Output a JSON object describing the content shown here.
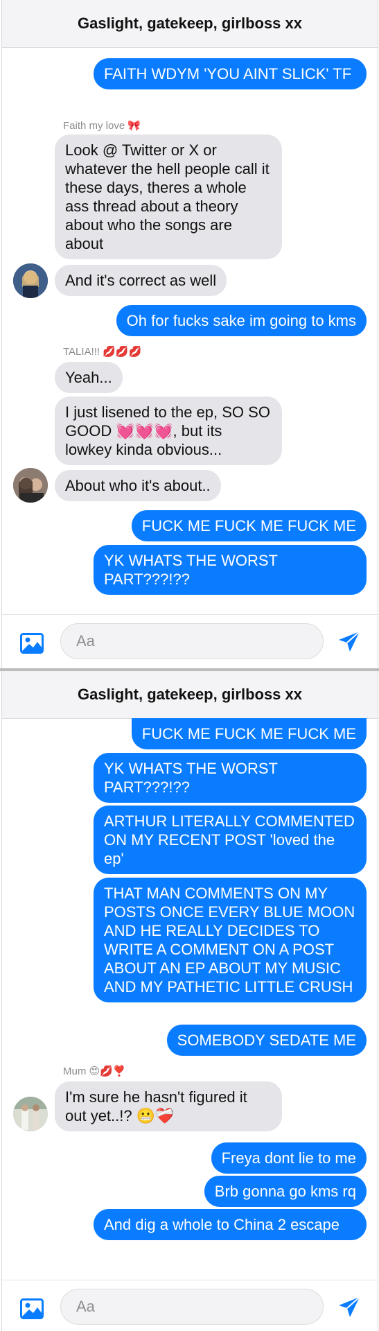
{
  "chat_title": "Gaslight, gatekeep, girlboss xx",
  "input_placeholder": "Aa",
  "senders": {
    "faith": "Faith my love 🎀",
    "talia": "TALIA!!! 💋💋💋",
    "mum": "Mum 😍💋❣️"
  },
  "panel1": {
    "m1": "FAITH WDYM 'YOU AINT SLICK' TF",
    "m2": "Look @ Twitter or X or whatever the hell people call it these days, theres a whole ass thread about a theory about who the songs are about",
    "m3": "And it's correct as well",
    "m4": "Oh for fucks sake im going to kms",
    "m5": "Yeah...",
    "m6": "I just lisened to the ep, SO SO GOOD 💓💓💓, but its lowkey kinda obvious...",
    "m7": "About who it's about..",
    "m8": "FUCK ME FUCK ME FUCK ME",
    "m9": "YK WHATS THE WORST PART???!??"
  },
  "panel2": {
    "m1": "FUCK ME FUCK ME FUCK ME",
    "m2": "YK WHATS THE WORST PART???!??",
    "m3": "ARTHUR LITERALLY COMMENTED ON MY RECENT POST 'loved the ep'",
    "m4": "THAT MAN COMMENTS ON MY POSTS ONCE EVERY BLUE MOON AND HE REALLY DECIDES TO WRITE A COMMENT ON A POST ABOUT AN EP ABOUT MY MUSIC AND MY PATHETIC LITTLE CRUSH",
    "m5": "SOMEBODY SEDATE ME",
    "m6": "I'm sure he hasn't figured it out yet..!? 😬❤️‍🩹",
    "m7": "Freya dont lie to me",
    "m8": "Brb gonna go kms rq",
    "m9": "And dig a whole to China 2 escape"
  },
  "colors": {
    "outgoing_bubble": "#0a7cff",
    "incoming_bubble": "#e4e4e9",
    "header_bg": "#f4f4f6"
  },
  "icons": {
    "photo": "photo-icon",
    "send": "send-icon"
  }
}
